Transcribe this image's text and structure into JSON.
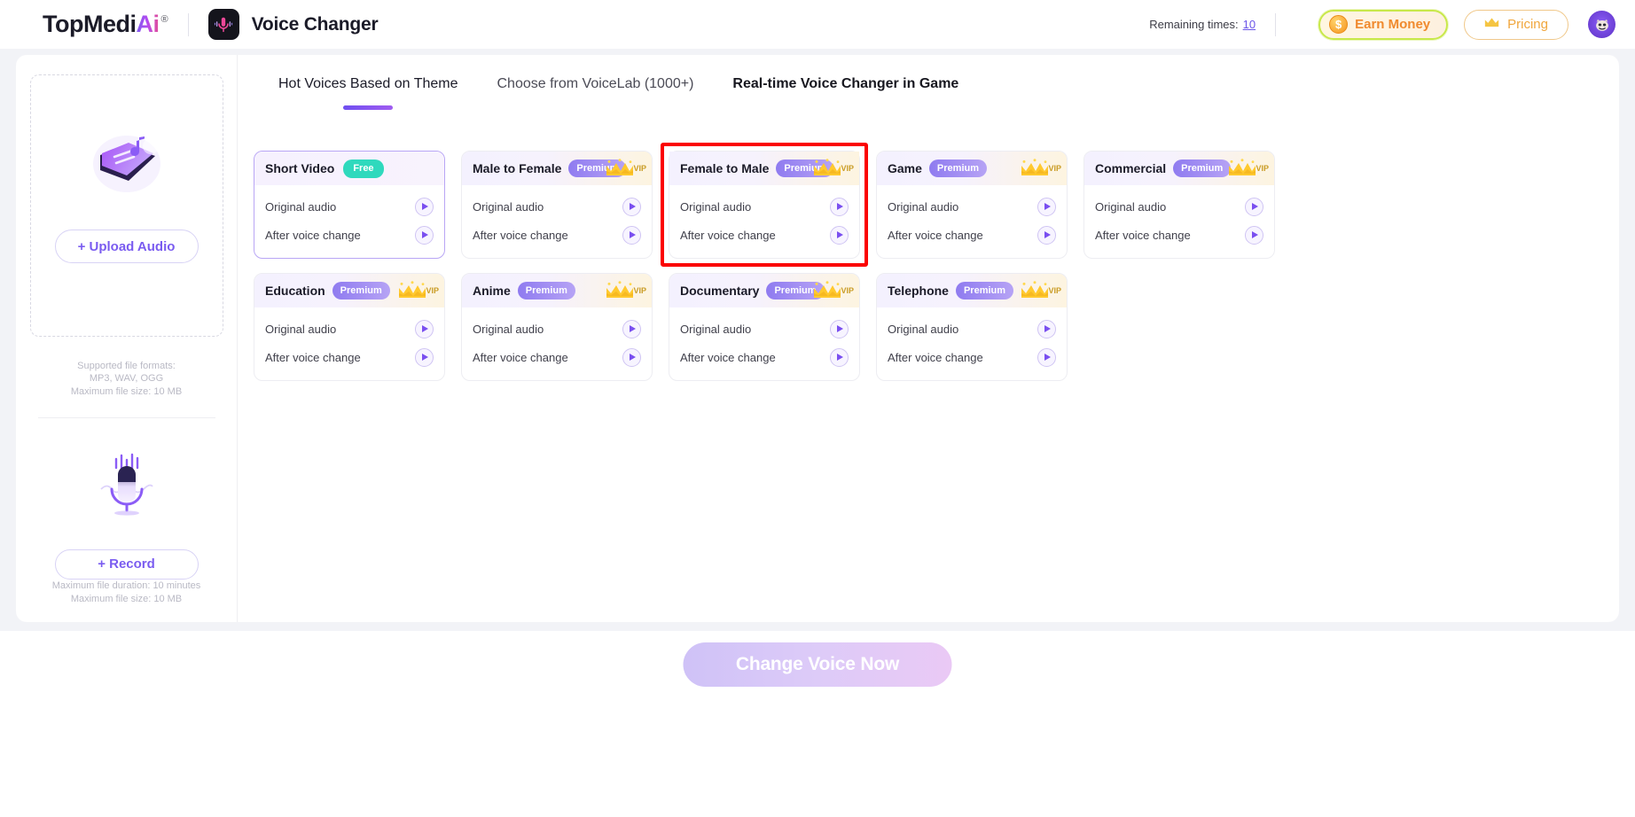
{
  "header": {
    "brand_main": "TopMedi",
    "brand_accent": "Ai",
    "brand_reg": "®",
    "app_icon_name": "microphone-app-icon",
    "app_title": "Voice Changer",
    "remaining_label": "Remaining times:",
    "remaining_value": "10",
    "earn_money_label": "Earn Money",
    "earn_money_icon": "coin-icon",
    "pricing_label": "Pricing",
    "pricing_icon": "crown-icon",
    "avatar_icon": "user-avatar",
    "accent_purple": "#7a5cf0",
    "earn_border": "#c8e84a",
    "pricing_color": "#f0a63c"
  },
  "sidebar": {
    "upload_icon": "folder-music-upload-icon",
    "upload_label": "+ Upload Audio",
    "formats_line1": "Supported file formats:",
    "formats_line2": "MP3, WAV, OGG",
    "formats_line3": "Maximum file size: 10 MB",
    "record_icon": "microphone-waveform-icon",
    "record_label": "+ Record",
    "duration_line1": "Maximum file duration: 10 minutes",
    "duration_line2": "Maximum file size: 10 MB"
  },
  "tabs": [
    {
      "label": "Hot Voices Based on Theme",
      "active": true,
      "bold": false
    },
    {
      "label": "Choose from VoiceLab (1000+)",
      "active": false,
      "bold": false
    },
    {
      "label": "Real-time Voice Changer in Game",
      "active": false,
      "bold": true
    }
  ],
  "cards": [
    {
      "title": "Short Video",
      "badge": "Free",
      "badge_type": "free",
      "vip": false,
      "selected": true,
      "highlighted": false,
      "original_label": "Original audio",
      "changed_label": "After voice change"
    },
    {
      "title": "Male to Female",
      "badge": "Premium",
      "badge_type": "premium",
      "vip": true,
      "selected": false,
      "highlighted": false,
      "original_label": "Original audio",
      "changed_label": "After voice change"
    },
    {
      "title": "Female to Male",
      "badge": "Premium",
      "badge_type": "premium",
      "vip": true,
      "selected": false,
      "highlighted": true,
      "original_label": "Original audio",
      "changed_label": "After voice change"
    },
    {
      "title": "Game",
      "badge": "Premium",
      "badge_type": "premium",
      "vip": true,
      "selected": false,
      "highlighted": false,
      "original_label": "Original audio",
      "changed_label": "After voice change"
    },
    {
      "title": "Commercial",
      "badge": "Premium",
      "badge_type": "premium",
      "vip": true,
      "selected": false,
      "highlighted": false,
      "original_label": "Original audio",
      "changed_label": "After voice change"
    },
    {
      "title": "Education",
      "badge": "Premium",
      "badge_type": "premium",
      "vip": true,
      "selected": false,
      "highlighted": false,
      "original_label": "Original audio",
      "changed_label": "After voice change"
    },
    {
      "title": "Anime",
      "badge": "Premium",
      "badge_type": "premium",
      "vip": true,
      "selected": false,
      "highlighted": false,
      "original_label": "Original audio",
      "changed_label": "After voice change"
    },
    {
      "title": "Documentary",
      "badge": "Premium",
      "badge_type": "premium",
      "vip": true,
      "selected": false,
      "highlighted": false,
      "original_label": "Original audio",
      "changed_label": "After voice change"
    },
    {
      "title": "Telephone",
      "badge": "Premium",
      "badge_type": "premium",
      "vip": true,
      "selected": false,
      "highlighted": false,
      "original_label": "Original audio",
      "changed_label": "After voice change"
    }
  ],
  "vip_text": "VIP",
  "footer": {
    "cta_label": "Change Voice Now",
    "cta_disabled": true
  }
}
